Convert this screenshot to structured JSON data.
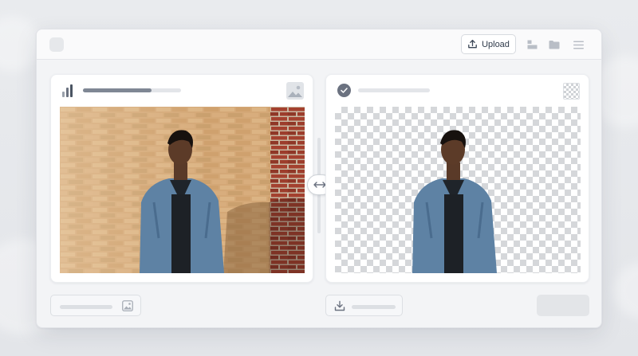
{
  "toolbar": {
    "upload_label": "Upload",
    "icons": [
      "app-logo",
      "upload-icon",
      "layout-icon",
      "folder-icon",
      "menu-icon"
    ]
  },
  "original_panel": {
    "progress_percent": 70,
    "icons": [
      "bar-chart-icon",
      "image-icon"
    ]
  },
  "result_panel": {
    "icons": [
      "check-icon",
      "transparency-icon"
    ]
  },
  "compare_slider": {
    "icon": "left-right-arrow-icon"
  },
  "footer": {
    "icons": [
      "image-icon",
      "download-icon"
    ]
  },
  "colors": {
    "brick_wall": "#d2a572",
    "red_brick": "#9e3f2f",
    "denim": "#5d7fa0",
    "accent_gray": "#6b7280"
  }
}
